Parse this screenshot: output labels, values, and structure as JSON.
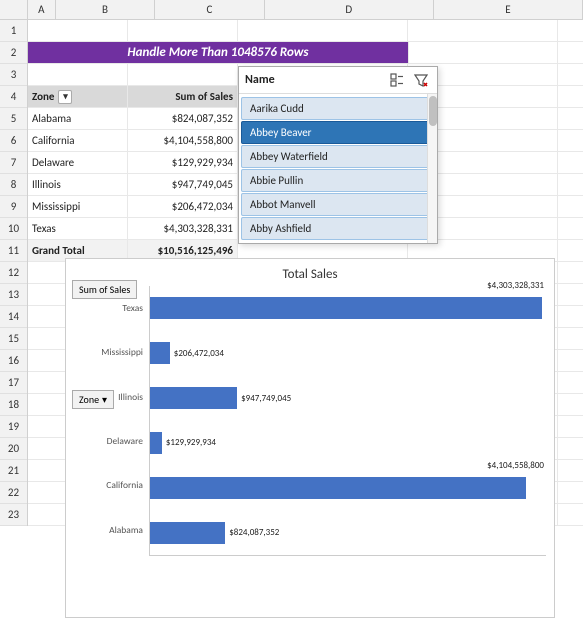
{
  "title": "Handle More Than 1048576 Rows",
  "columns": [
    "A",
    "B",
    "C",
    "D",
    "E"
  ],
  "pivot": {
    "header_zone": "Zone",
    "header_sales": "Sum of Sales",
    "rows": [
      {
        "zone": "Alabama",
        "sales": "$824,087,352"
      },
      {
        "zone": "California",
        "sales": "$4,104,558,800"
      },
      {
        "zone": "Delaware",
        "sales": "$129,929,934"
      },
      {
        "zone": "Illinois",
        "sales": "$947,749,045"
      },
      {
        "zone": "Mississippi",
        "sales": "$206,472,034"
      },
      {
        "zone": "Texas",
        "sales": "$4,303,328,331"
      }
    ],
    "grand_total_label": "Grand Total",
    "grand_total_value": "$10,516,125,496"
  },
  "slicer": {
    "title": "Name",
    "items": [
      {
        "name": "Aarika Cudd",
        "selected": false
      },
      {
        "name": "Abbey Beaver",
        "selected": true
      },
      {
        "name": "Abbey Waterfield",
        "selected": false
      },
      {
        "name": "Abbie Pullin",
        "selected": false
      },
      {
        "name": "Abbot Manvell",
        "selected": false
      },
      {
        "name": "Abby Ashfield",
        "selected": false
      }
    ]
  },
  "chart": {
    "title": "Total Sales",
    "legend_label": "Sum of Sales",
    "zone_filter_label": "Zone",
    "bars": [
      {
        "label": "Texas",
        "value": 4303328331,
        "display": "$4,303,328,331",
        "width_pct": 99
      },
      {
        "label": "Mississippi",
        "value": 206472034,
        "display": "$206,472,034",
        "width_pct": 5
      },
      {
        "label": "Illinois",
        "value": 947749045,
        "display": "$947,749,045",
        "width_pct": 22
      },
      {
        "label": "Delaware",
        "value": 129929934,
        "display": "$129,929,934",
        "width_pct": 3
      },
      {
        "label": "California",
        "value": 4104558800,
        "display": "$4,104,558,800",
        "width_pct": 95
      },
      {
        "label": "Alabama",
        "value": 824087352,
        "display": "$824,087,352",
        "width_pct": 19
      }
    ]
  },
  "row_numbers": [
    "1",
    "2",
    "3",
    "4",
    "5",
    "6",
    "7",
    "8",
    "9",
    "10",
    "11",
    "12",
    "13",
    "14",
    "15",
    "16",
    "17",
    "18",
    "19",
    "20",
    "21",
    "22",
    "23"
  ]
}
